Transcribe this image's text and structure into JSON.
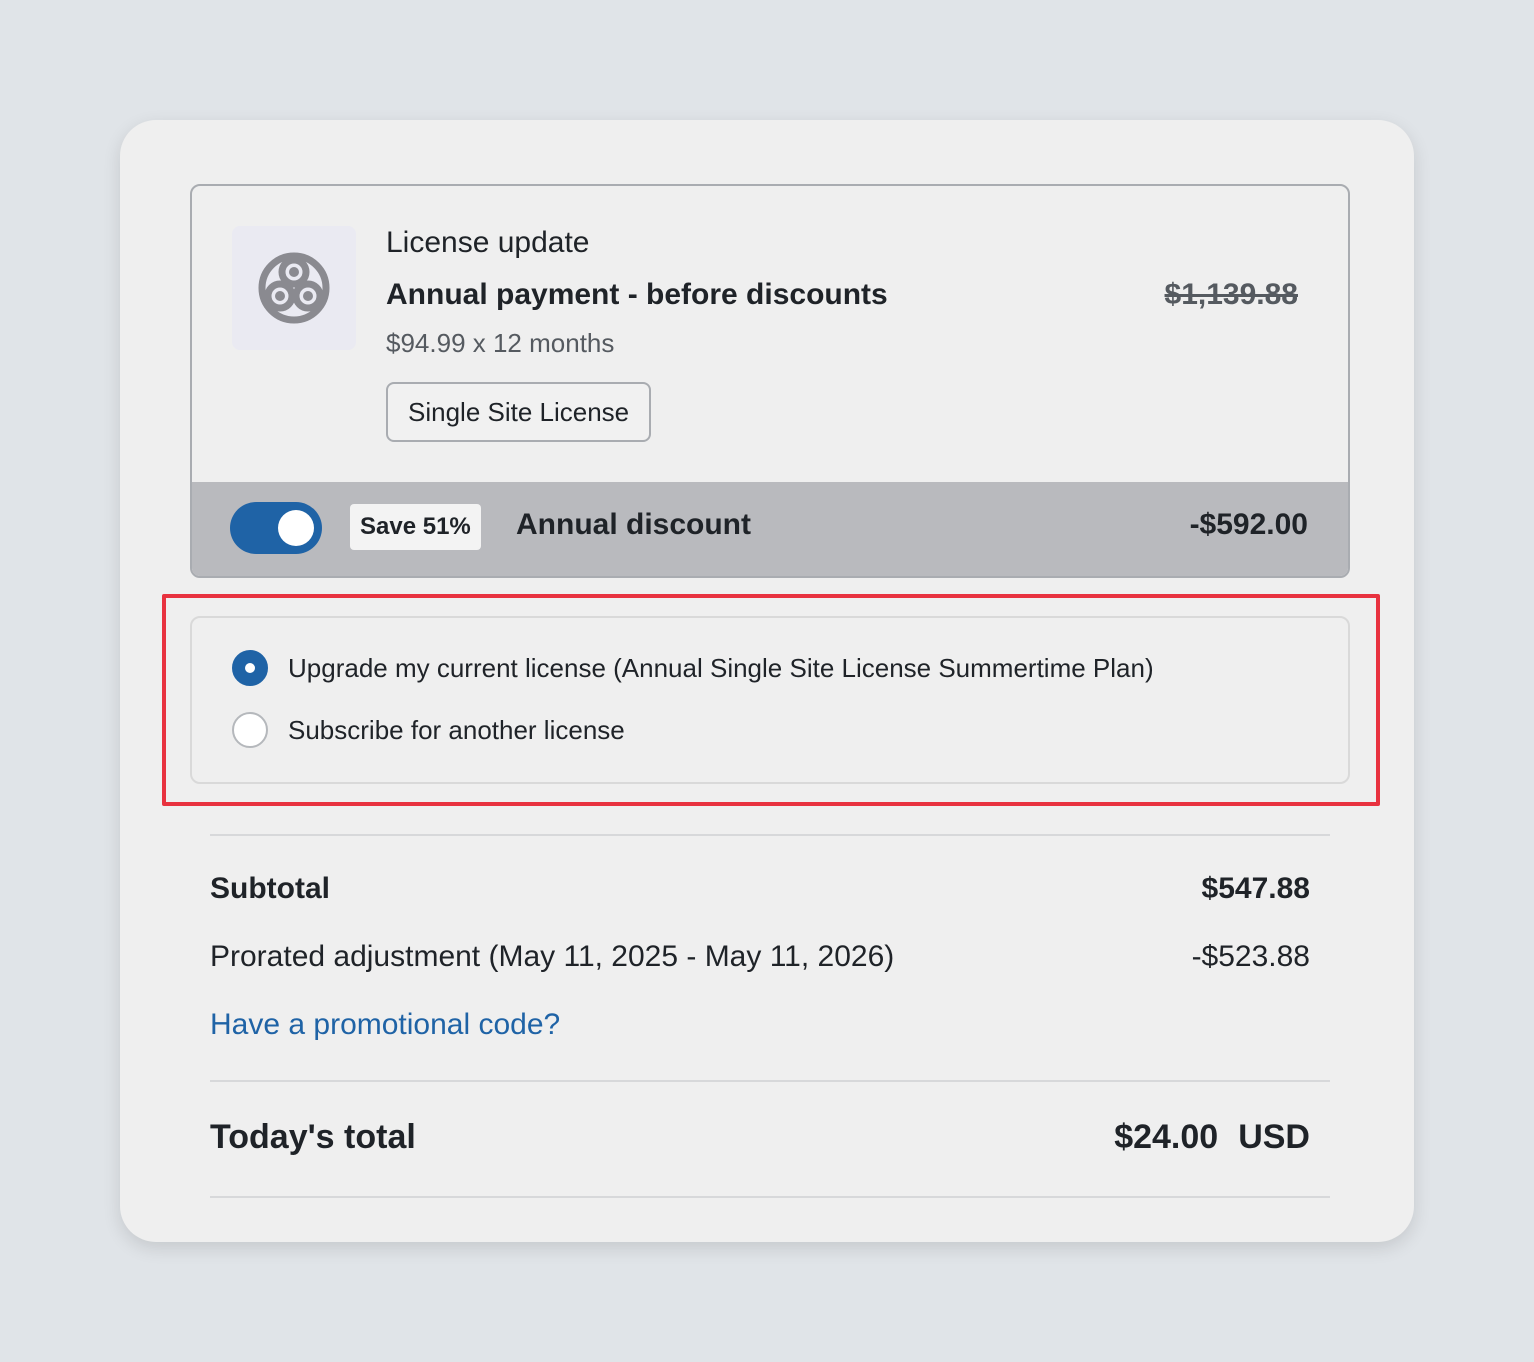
{
  "product": {
    "logo_icon": "orbit-logo-icon",
    "label": "License update",
    "title": "Annual payment - before discounts",
    "original_price": "$1,139.88",
    "per_month": "$94.99 x 12 months",
    "license_type": "Single Site License"
  },
  "discount": {
    "toggle_on": true,
    "save_badge": "Save 51%",
    "label": "Annual discount",
    "amount": "-$592.00"
  },
  "options": [
    {
      "label": "Upgrade my current license (Annual Single Site License Summertime Plan)",
      "selected": true
    },
    {
      "label": "Subscribe for another license",
      "selected": false
    }
  ],
  "summary": {
    "subtotal_label": "Subtotal",
    "subtotal_value": "$547.88",
    "prorated_label": "Prorated adjustment (May 11, 2025 - May 11, 2026)",
    "prorated_value": "-$523.88",
    "promo_link": "Have a promotional code?",
    "total_label": "Today's total",
    "total_amount": "$24.00",
    "total_currency": "USD"
  },
  "colors": {
    "accent": "#1f63a6",
    "highlight": "#e8323f",
    "background": "#e0e4e8",
    "card": "#efefef"
  }
}
